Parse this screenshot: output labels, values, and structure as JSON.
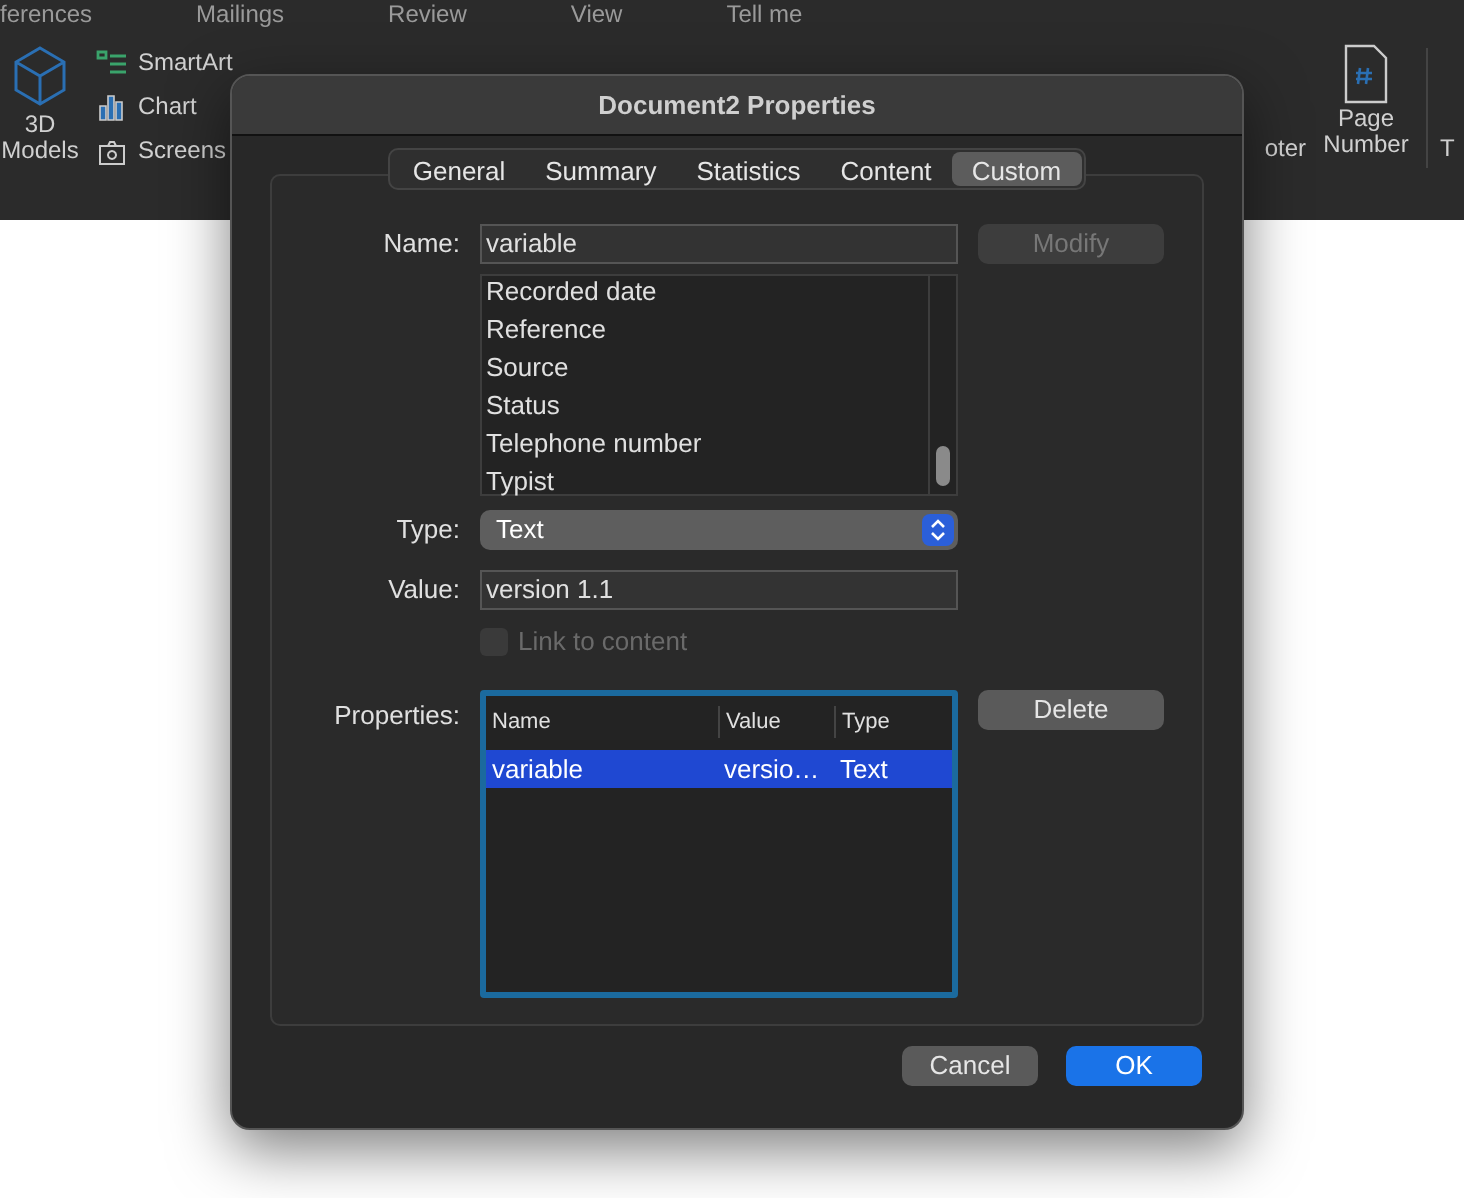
{
  "app_tabs": [
    "ferences",
    "Mailings",
    "Review",
    "View",
    "Tell me"
  ],
  "ribbon": {
    "models_button": "3D Models",
    "insert_items": [
      "SmartArt",
      "Chart",
      "Screens"
    ],
    "footer_button": "oter",
    "page_number_button": "Page Number",
    "text_button": "T"
  },
  "dialog": {
    "title": "Document2 Properties",
    "tabs": [
      {
        "label": "General",
        "selected": false
      },
      {
        "label": "Summary",
        "selected": false
      },
      {
        "label": "Statistics",
        "selected": false
      },
      {
        "label": "Content",
        "selected": false
      },
      {
        "label": "Custom",
        "selected": true
      }
    ],
    "name": {
      "label": "Name:",
      "value": "variable"
    },
    "modify_button": {
      "label": "Modify",
      "disabled": true
    },
    "name_list": [
      "Recorded date",
      "Reference",
      "Source",
      "Status",
      "Telephone number",
      "Typist"
    ],
    "type": {
      "label": "Type:",
      "value": "Text"
    },
    "value": {
      "label": "Value:",
      "value": "version 1.1"
    },
    "link_to_content": {
      "label": "Link to content",
      "checked": false,
      "disabled": true
    },
    "properties": {
      "label": "Properties:",
      "columns": [
        "Name",
        "Value",
        "Type"
      ],
      "rows": [
        {
          "cells": [
            "variable",
            "versio…",
            "Text"
          ],
          "selected": true
        }
      ]
    },
    "delete_button": "Delete",
    "buttons": [
      {
        "label": "Cancel",
        "kind": "secondary"
      },
      {
        "label": "OK",
        "kind": "default"
      }
    ]
  }
}
